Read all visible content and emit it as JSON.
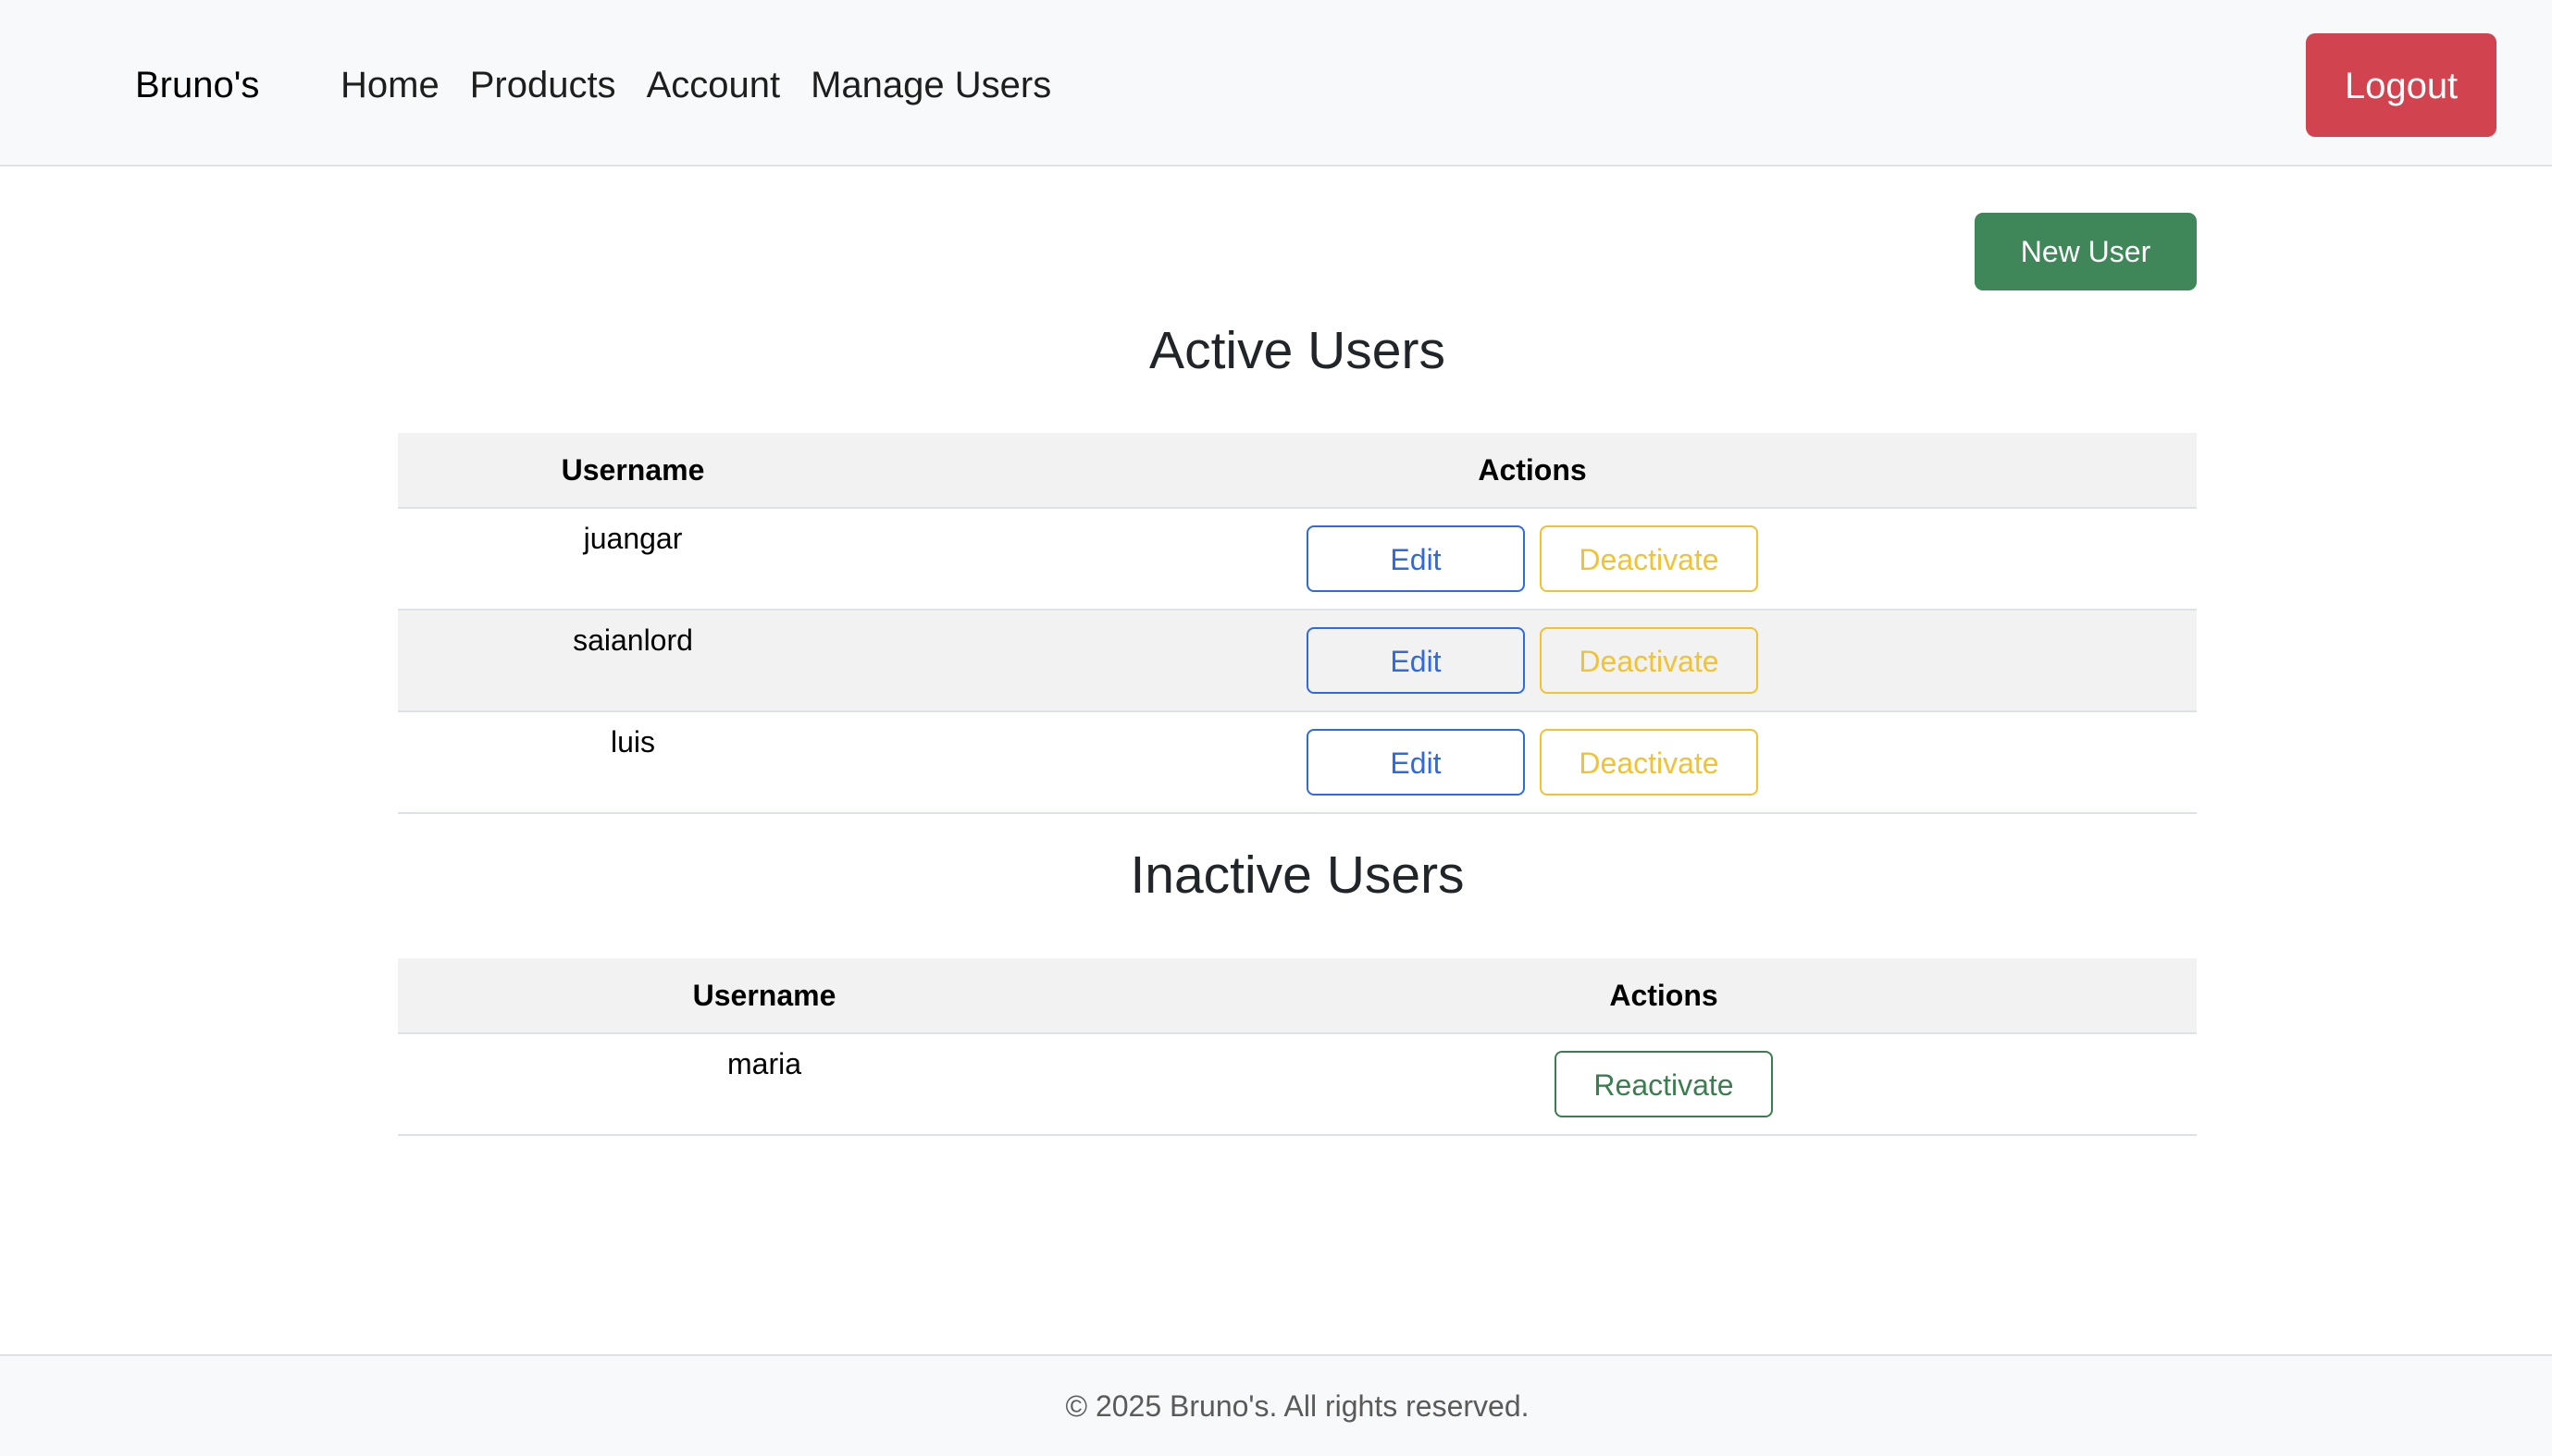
{
  "navbar": {
    "brand": "Bruno's",
    "links": [
      {
        "label": "Home"
      },
      {
        "label": "Products"
      },
      {
        "label": "Account"
      },
      {
        "label": "Manage Users"
      }
    ],
    "logout_label": "Logout"
  },
  "toolbar": {
    "new_user_label": "New User"
  },
  "active_users": {
    "title": "Active Users",
    "headers": {
      "username": "Username",
      "actions": "Actions"
    },
    "rows": [
      {
        "username": "juangar",
        "edit_label": "Edit",
        "deactivate_label": "Deactivate"
      },
      {
        "username": "saianlord",
        "edit_label": "Edit",
        "deactivate_label": "Deactivate"
      },
      {
        "username": "luis",
        "edit_label": "Edit",
        "deactivate_label": "Deactivate"
      }
    ]
  },
  "inactive_users": {
    "title": "Inactive Users",
    "headers": {
      "username": "Username",
      "actions": "Actions"
    },
    "rows": [
      {
        "username": "maria",
        "reactivate_label": "Reactivate"
      }
    ]
  },
  "footer": {
    "text": "© 2025 Bruno's. All rights reserved."
  },
  "colors": {
    "logout": "#d0434f",
    "new_user": "#3f8758",
    "edit": "#2f6ae0",
    "deactivate": "#f1c232",
    "reactivate": "#3a7e4f"
  }
}
